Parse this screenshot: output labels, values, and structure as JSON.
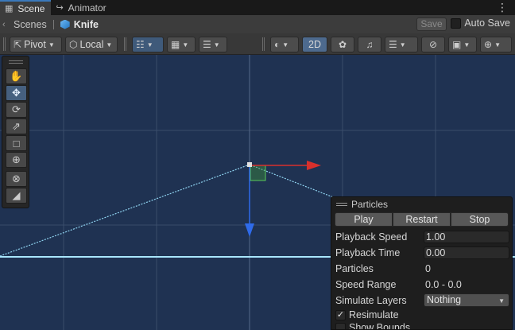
{
  "tabs": [
    {
      "label": "Scene",
      "icon": "grid-icon",
      "active": true
    },
    {
      "label": "Animator",
      "icon": "animator-icon",
      "active": false
    }
  ],
  "breadcrumb": {
    "root": "Scenes",
    "current": "Knife"
  },
  "scene_header": {
    "save_label": "Save",
    "auto_save_label": "Auto Save",
    "auto_save_checked": false
  },
  "toolbar": {
    "pivot_label": "Pivot",
    "space_label": "Local",
    "mode_2d_label": "2D"
  },
  "tools": [
    {
      "name": "hand-tool",
      "icon": "hand-icon"
    },
    {
      "name": "move-tool",
      "icon": "move-icon",
      "selected": true
    },
    {
      "name": "rotate-tool",
      "icon": "rotate-icon"
    },
    {
      "name": "scale-tool",
      "icon": "scale-icon"
    },
    {
      "name": "rect-tool",
      "icon": "rect-icon"
    },
    {
      "name": "transform-tool",
      "icon": "transform-icon"
    },
    {
      "name": "custom-tool",
      "icon": "custom-icon"
    },
    {
      "name": "editor-tool",
      "icon": "editor-icon"
    }
  ],
  "particles": {
    "title": "Particles",
    "play_label": "Play",
    "restart_label": "Restart",
    "stop_label": "Stop",
    "playback_speed_label": "Playback Speed",
    "playback_speed": "1.00",
    "playback_time_label": "Playback Time",
    "playback_time": "0.00",
    "particles_label": "Particles",
    "particles_count": "0",
    "speed_range_label": "Speed Range",
    "speed_range": "0.0 - 0.0",
    "simulate_layers_label": "Simulate Layers",
    "simulate_layers": "Nothing",
    "resimulate_label": "Resimulate",
    "resimulate_checked": true,
    "show_bounds_label": "Show Bounds",
    "show_bounds_checked": false
  },
  "colors": {
    "scene_bg": "#1f3252",
    "grid": "#3a4c6b",
    "shape_outline": "#8fd3f0",
    "x_axis": "#d8302c",
    "y_axis": "#2f6bea",
    "accent": "#3a79bb"
  }
}
